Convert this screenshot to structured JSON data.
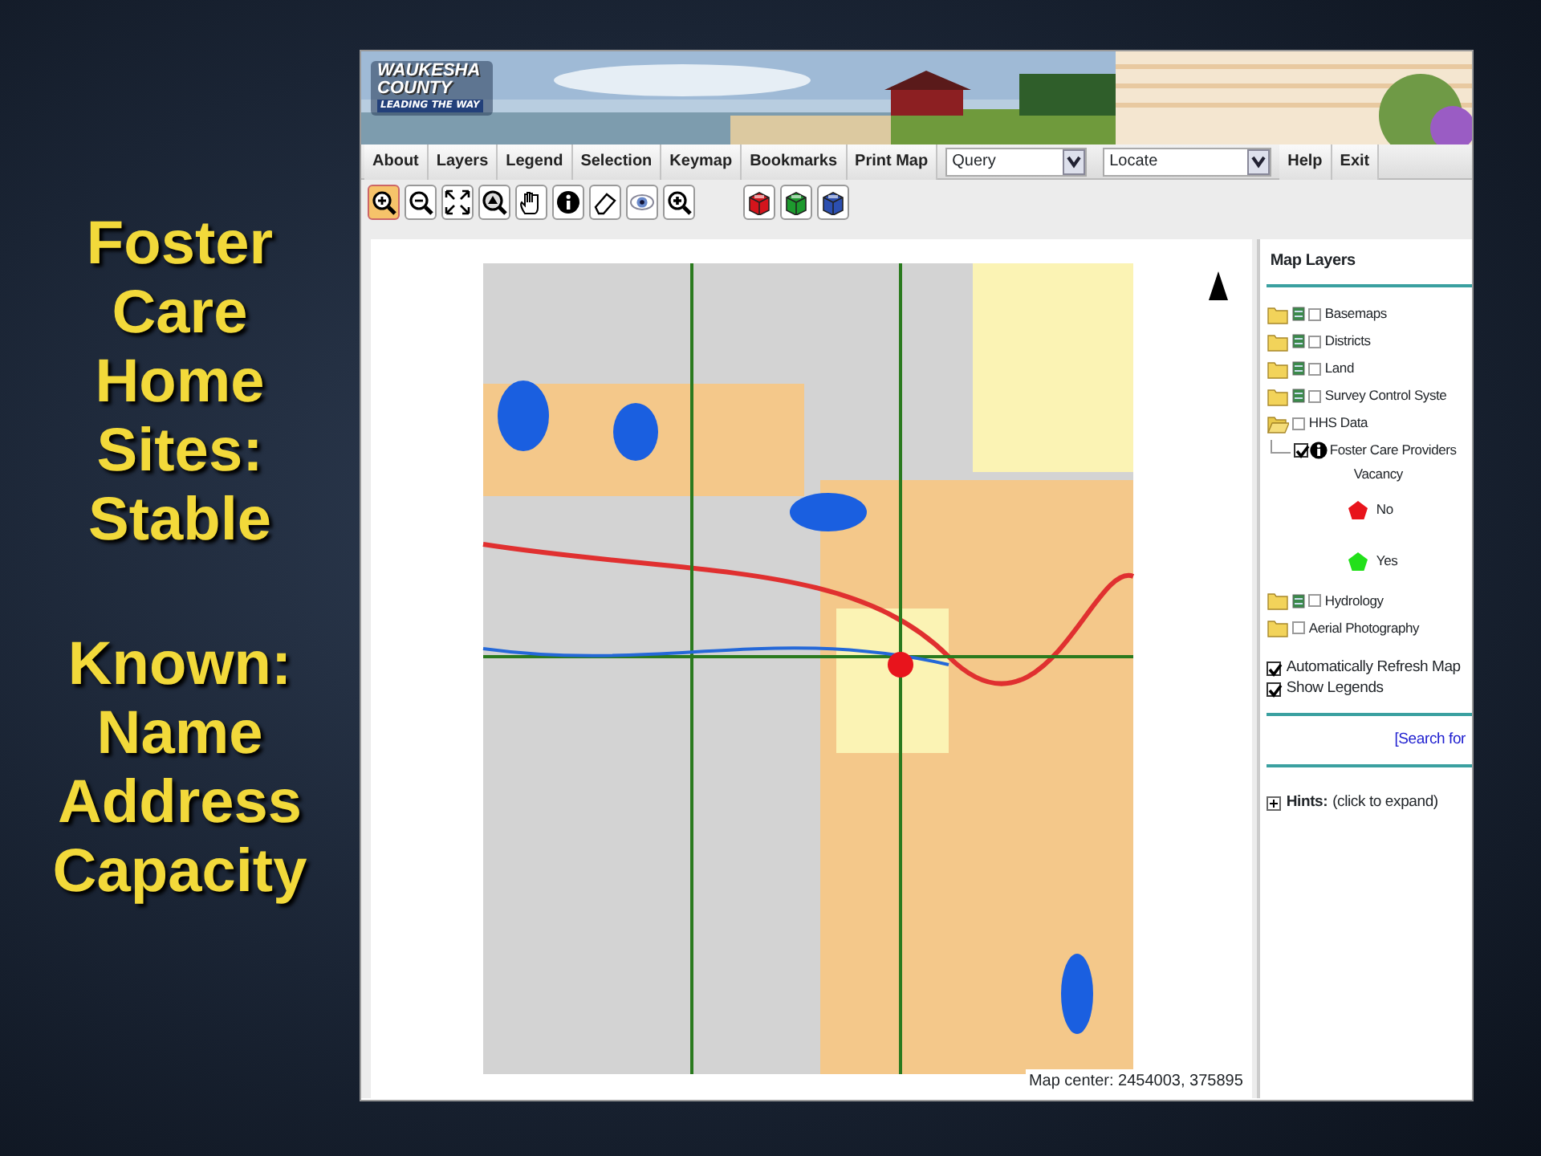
{
  "slide": {
    "heading": "Foster Care Home Sites: Stable",
    "subheading": "Known: Name Address Capacity"
  },
  "banner": {
    "logo_lines": [
      "WAUKESHA",
      "COUNTY"
    ],
    "tagline": "LEADING THE WAY"
  },
  "menu": [
    {
      "kind": "button",
      "label": "About"
    },
    {
      "kind": "button",
      "label": "Layers"
    },
    {
      "kind": "button",
      "label": "Legend"
    },
    {
      "kind": "button",
      "label": "Selection"
    },
    {
      "kind": "button",
      "label": "Keymap"
    },
    {
      "kind": "button",
      "label": "Bookmarks"
    },
    {
      "kind": "button",
      "label": "Print Map"
    },
    {
      "kind": "dropdown",
      "label": "Query"
    },
    {
      "kind": "dropdown",
      "label": "Locate"
    },
    {
      "kind": "button",
      "label": "Help"
    },
    {
      "kind": "button",
      "label": "Exit"
    }
  ],
  "tools": [
    {
      "kind": "zoom-in",
      "selected": true
    },
    {
      "kind": "zoom-out",
      "selected": false
    },
    {
      "kind": "full-extent",
      "selected": false
    },
    {
      "kind": "zoom-layer",
      "selected": false
    },
    {
      "kind": "pan",
      "selected": false
    },
    {
      "kind": "info",
      "selected": false
    },
    {
      "kind": "eraser",
      "selected": false
    },
    {
      "kind": "eye",
      "selected": false
    },
    {
      "kind": "zoom-plus",
      "selected": false
    },
    {
      "kind": "red-box",
      "selected": false
    },
    {
      "kind": "green-box",
      "selected": false
    },
    {
      "kind": "blue-box",
      "selected": false
    }
  ],
  "map": {
    "kind": "picture",
    "map_center": "Map center: 2454003, 375895"
  },
  "layers_panel": {
    "title": "Map Layers",
    "layers": [
      {
        "label": "Basemaps",
        "expanded": false,
        "legend_icon": true,
        "checked": false
      },
      {
        "label": "Districts",
        "expanded": false,
        "legend_icon": true,
        "checked": false
      },
      {
        "label": "Land",
        "expanded": false,
        "legend_icon": true,
        "checked": false
      },
      {
        "label": "Survey Control Syste",
        "expanded": false,
        "legend_icon": true,
        "checked": false
      },
      {
        "label": "HHS Data",
        "expanded": true,
        "legend_icon": false,
        "checked": false,
        "children": [
          {
            "label": "Foster Care Providers",
            "checked": true,
            "legend_title": "Vacancy",
            "legend": [
              {
                "label": "No",
                "color": "#e8141c"
              },
              {
                "label": "Yes",
                "color": "#22e01a"
              }
            ]
          }
        ]
      },
      {
        "label": "Hydrology",
        "expanded": false,
        "legend_icon": true,
        "checked": false
      },
      {
        "label": "Aerial Photography",
        "expanded": false,
        "legend_icon": false,
        "checked": false
      }
    ],
    "options": [
      {
        "label": "Automatically Refresh Map",
        "checked": true
      },
      {
        "label": "Show Legends",
        "checked": true
      }
    ],
    "search_link": "[Search for",
    "hints": {
      "label": "Hints:",
      "note": "(click to expand)",
      "expanded": false
    }
  }
}
